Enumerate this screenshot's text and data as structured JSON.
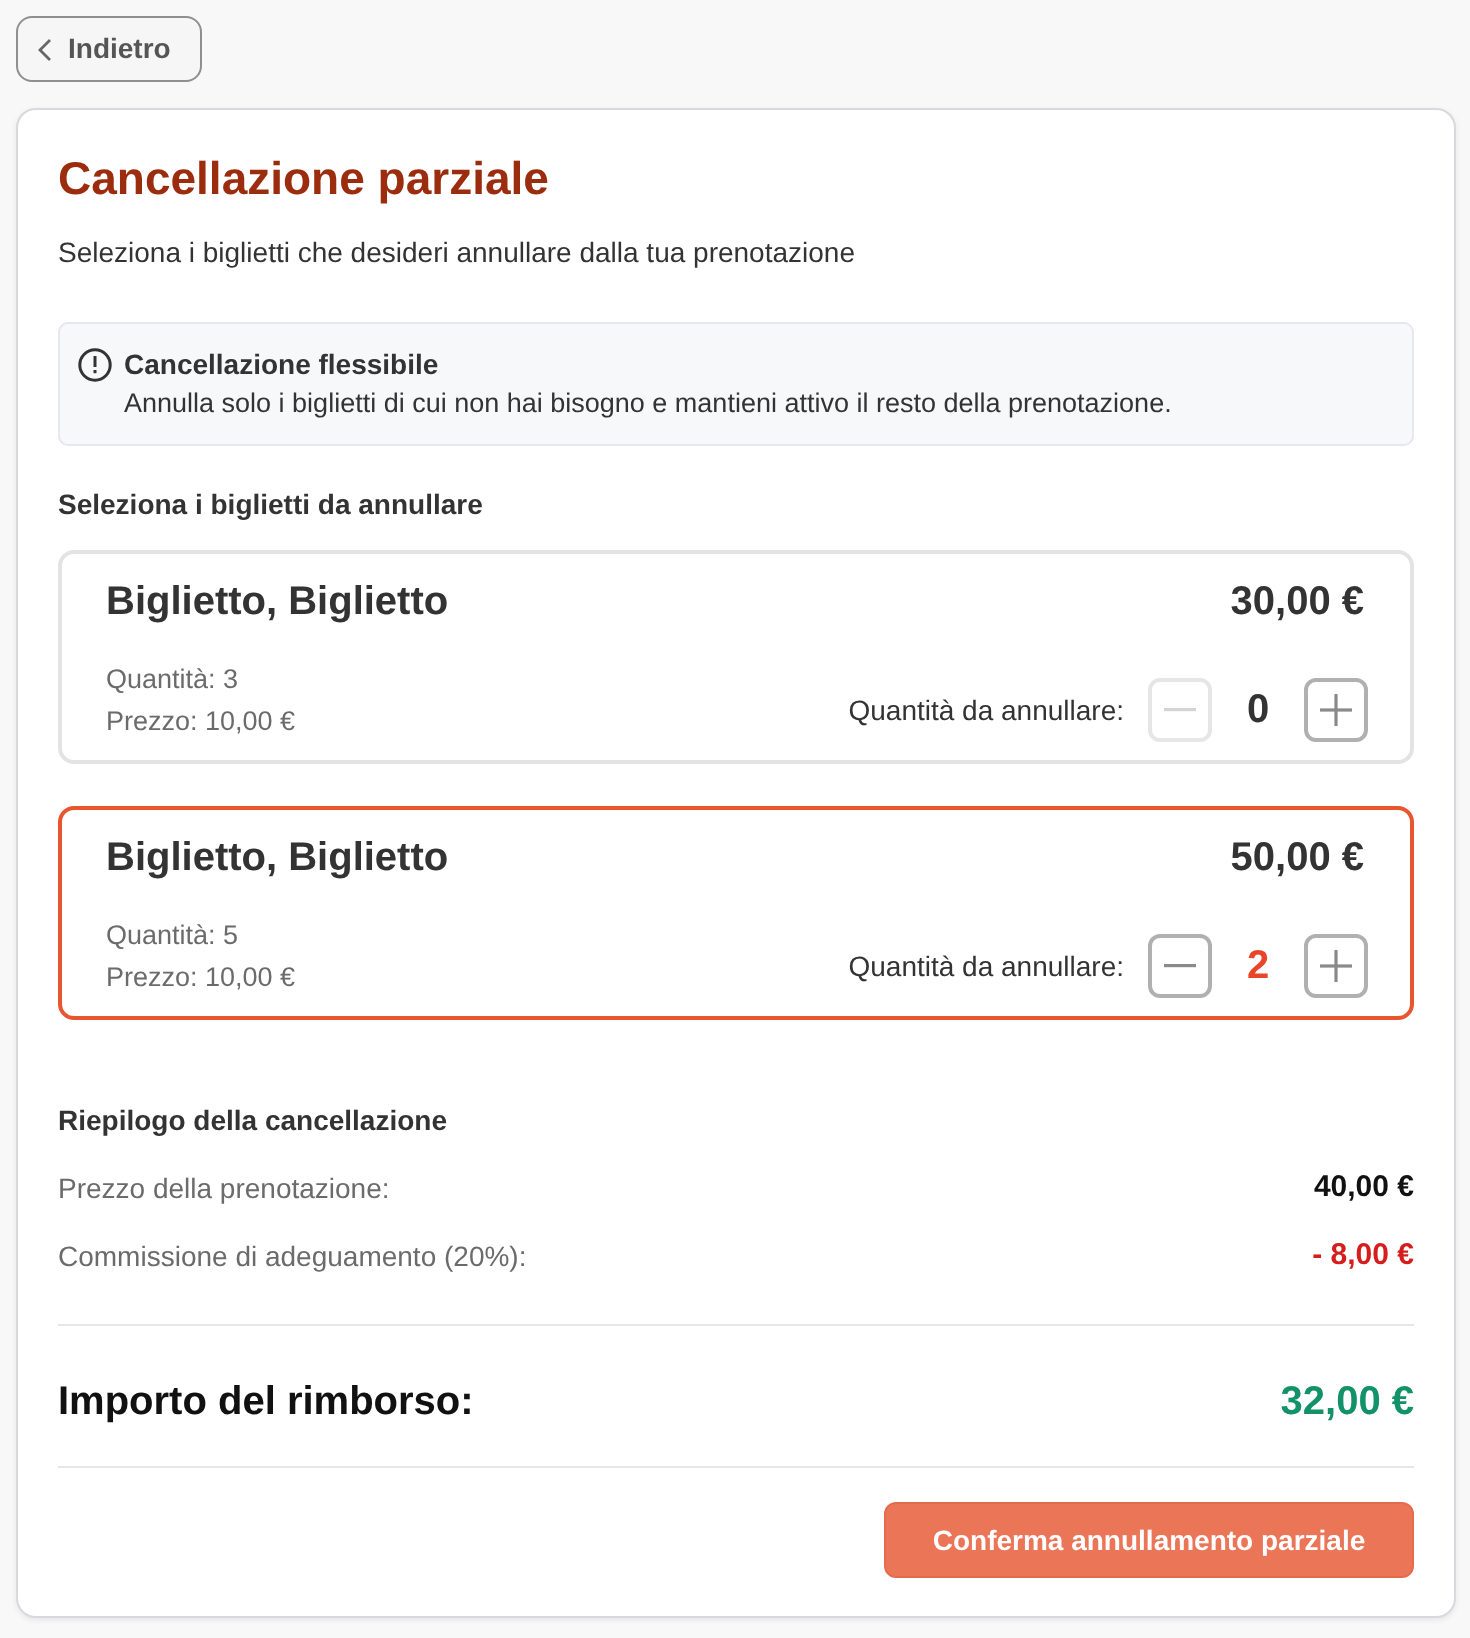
{
  "back_button": {
    "label": "Indietro"
  },
  "title": "Cancellazione parziale",
  "subtitle": "Seleziona i biglietti che desideri annullare dalla tua prenotazione",
  "notice": {
    "title": "Cancellazione flessibile",
    "text": "Annulla solo i biglietti di cui non hai bisogno e mantieni attivo il resto della prenotazione."
  },
  "tickets_heading": "Seleziona i biglietti da annullare",
  "tickets": [
    {
      "name": "Biglietto, Biglietto",
      "total": "30,00 €",
      "quantity": "Quantità: 3",
      "price": "Prezzo: 10,00 €",
      "cancel_label": "Quantità da annullare:",
      "cancel_count": "0",
      "selected": false,
      "decrement_disabled": true
    },
    {
      "name": "Biglietto, Biglietto",
      "total": "50,00 €",
      "quantity": "Quantità: 5",
      "price": "Prezzo: 10,00 €",
      "cancel_label": "Quantità da annullare:",
      "cancel_count": "2",
      "selected": true,
      "decrement_disabled": false
    }
  ],
  "summary": {
    "heading": "Riepilogo della cancellazione",
    "rows": [
      {
        "label": "Prezzo della prenotazione:",
        "value": "40,00 €",
        "kind": "charge"
      },
      {
        "label": "Commissione di adeguamento (20%):",
        "value": "- 8,00 €",
        "kind": "deduction"
      }
    ],
    "refund": {
      "label": "Importo del rimborso:",
      "value": "32,00 €"
    }
  },
  "confirm_button": {
    "label": "Conferma annullamento parziale"
  }
}
